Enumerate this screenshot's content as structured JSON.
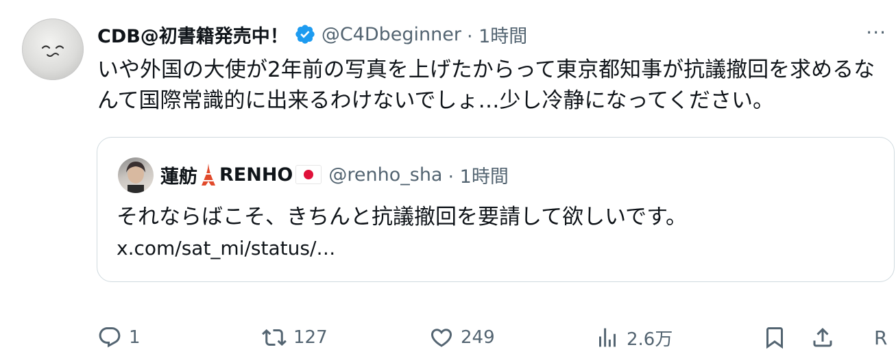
{
  "tweet": {
    "author": {
      "display_name": "CDB@初書籍発売中！",
      "handle": "@C4Dbeginner",
      "verified": true,
      "avatar_icon": "smiling-mochi-avatar-icon"
    },
    "timestamp": "· 1時間",
    "more_icon": "more-options-icon",
    "more_glyph": "···",
    "text": "いや外国の大使が2年前の写真を上げたからって東京都知事が抗議撤回を求めるなんて国際常識的に出来るわけないでしょ…少し冷静になってください。"
  },
  "quote": {
    "author": {
      "display_name": "蓮舫",
      "display_name_suffix": "RENHO",
      "tower_icon": "tokyo-tower-emoji-icon",
      "flag_icon": "japan-flag-emoji-icon",
      "handle": "@renho_sha"
    },
    "timestamp": "· 1時間",
    "text": "それならばこそ、きちんと抗議撤回を要請して欲しいです。",
    "link": "x.com/sat_mi/status/…"
  },
  "actions": {
    "reply_count": "1",
    "retweet_count": "127",
    "like_count": "249",
    "views_count": "2.6万",
    "extra_glyph": "R"
  },
  "colors": {
    "text_primary": "#0f1419",
    "text_secondary": "#536471",
    "verified_blue": "#1d9bf0",
    "border": "#cfd9de",
    "flag_red": "#e0113a"
  }
}
